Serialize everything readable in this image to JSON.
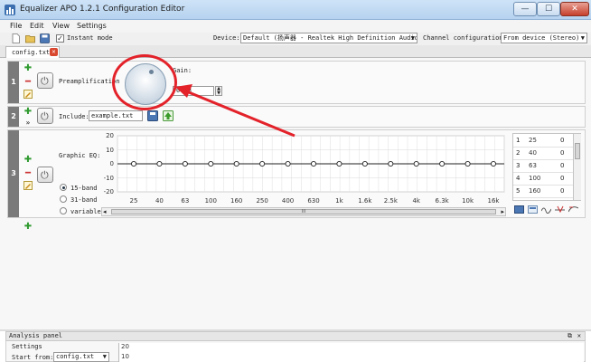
{
  "window": {
    "title": "Equalizer APO 1.2.1 Configuration Editor",
    "min": "—",
    "max": "☐",
    "close": "✕"
  },
  "menu": [
    "File",
    "Edit",
    "View",
    "Settings"
  ],
  "toolbar": {
    "instant_mode_checked": true,
    "instant_mode_label": "Instant mode",
    "device_label": "Device:",
    "device_value": "Default (扬声器 - Realtek High Definition Audio)",
    "channel_label": "Channel configuration:",
    "channel_value": "From device (Stereo)"
  },
  "tab": {
    "label": "config.txt",
    "close": "✕"
  },
  "rows": [
    {
      "num": "1",
      "label": "Preamplification",
      "gain_label": "Gain:",
      "gain_value": "0 dB"
    },
    {
      "num": "2",
      "label": "Include:",
      "include_value": "example.txt"
    },
    {
      "num": "3",
      "label": "Graphic EQ:",
      "band_options": [
        "15-band",
        "31-band",
        "variable"
      ],
      "selected_band": "15-band"
    }
  ],
  "eq": {
    "y_ticks": [
      "20",
      "10",
      "0",
      "-10",
      "-20"
    ],
    "x_ticks": [
      "25",
      "40",
      "63",
      "100",
      "160",
      "250",
      "400",
      "630",
      "1k",
      "1.6k",
      "2.5k",
      "4k",
      "6.3k",
      "10k",
      "16k"
    ],
    "gains_db": [
      0,
      0,
      0,
      0,
      0,
      0,
      0,
      0,
      0,
      0,
      0,
      0,
      0,
      0,
      0
    ],
    "ylim": [
      -20,
      20
    ],
    "scroll_mark": "III",
    "scroll_left": "◂",
    "scroll_right": "▸"
  },
  "band_table": [
    {
      "idx": "1",
      "freq": "25",
      "gain": "0"
    },
    {
      "idx": "2",
      "freq": "40",
      "gain": "0"
    },
    {
      "idx": "3",
      "freq": "63",
      "gain": "0"
    },
    {
      "idx": "4",
      "freq": "100",
      "gain": "0"
    },
    {
      "idx": "5",
      "freq": "160",
      "gain": "0"
    }
  ],
  "analysis": {
    "title": "Analysis panel",
    "settings_label": "Settings",
    "start_from_label": "Start from:",
    "start_from_value": "config.txt",
    "y_ticks": [
      "20",
      "10"
    ],
    "float_icon": "⧉",
    "close_icon": "✕"
  },
  "colors": {
    "annotation": "#e3222a",
    "titlebar": "#cfe3f7",
    "row_number": "#7a7a7a"
  }
}
